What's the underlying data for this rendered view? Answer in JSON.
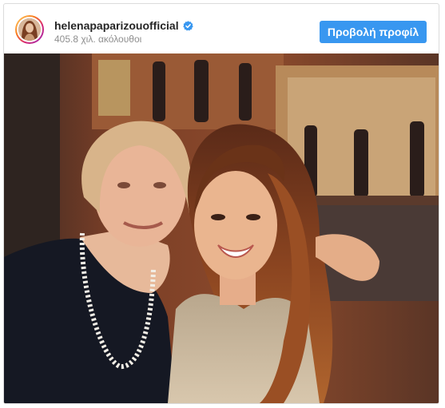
{
  "post": {
    "username": "helenapaparizouofficial",
    "followers": "405.8 χιλ. ακόλουθοι",
    "view_profile_label": "Προβολή προφίλ",
    "verified": true,
    "accent_color": "#3897f0",
    "verified_icon": "verified-badge-icon",
    "photo_description_icon": "post-photo"
  }
}
